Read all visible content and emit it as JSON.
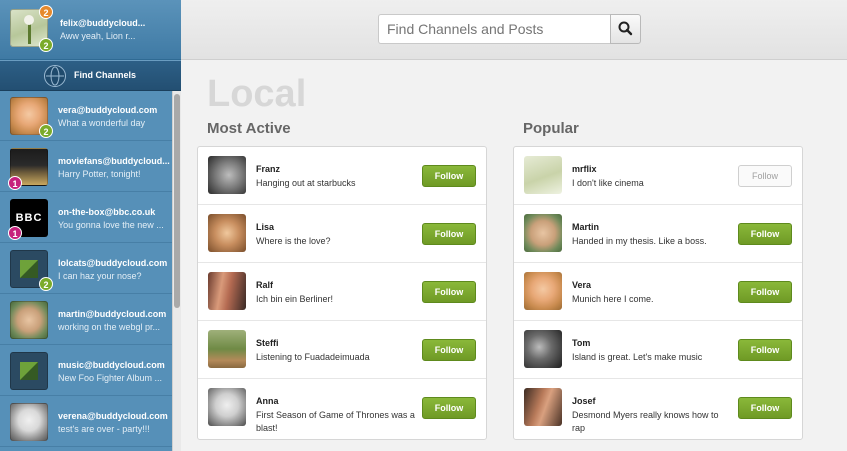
{
  "me": {
    "name": "felix@buddycloud...",
    "status": "Aww yeah, Lion r...",
    "badge_top": "2",
    "badge_bottom": "2"
  },
  "find_channels_label": "Find Channels",
  "channels": [
    {
      "name": "vera@buddycloud.com",
      "status": "What a wonderful day",
      "badge": "2",
      "badge_color": "#7bab2a"
    },
    {
      "name": "moviefans@buddycloud...",
      "status": "Harry Potter, tonight!",
      "badge": "1",
      "badge_color": "#c6207c"
    },
    {
      "name": "on-the-box@bbc.co.uk",
      "status": "You gonna love the new ...",
      "badge": "1",
      "badge_color": "#c6207c",
      "logo": "BBC"
    },
    {
      "name": "lolcats@buddycloud.com",
      "status": "I can haz your nose?",
      "badge": "2",
      "badge_color": "#7bab2a"
    },
    {
      "name": "martin@buddycloud.com",
      "status": "working on the webgl pr...",
      "badge": "",
      "badge_color": ""
    },
    {
      "name": "music@buddycloud.com",
      "status": "New Foo Fighter Album ...",
      "badge": "",
      "badge_color": ""
    },
    {
      "name": "verena@buddycloud.com",
      "status": "test's are over - party!!!",
      "badge": "",
      "badge_color": ""
    }
  ],
  "search": {
    "placeholder": "Find Channels and Posts"
  },
  "local_title": "Local",
  "most_active": {
    "title": "Most Active",
    "users": [
      {
        "name": "Franz",
        "status": "Hanging out at starbucks",
        "action": "Follow"
      },
      {
        "name": "Lisa",
        "status": "Where is the love?",
        "action": "Follow"
      },
      {
        "name": "Ralf",
        "status": "Ich bin ein Berliner!",
        "action": "Follow"
      },
      {
        "name": "Steffi",
        "status": "Listening to Fuadadeimuada",
        "action": "Follow"
      },
      {
        "name": "Anna",
        "status": "First Season of Game of Thrones was a blast!",
        "action": "Follow"
      }
    ]
  },
  "popular": {
    "title": "Popular",
    "users": [
      {
        "name": "mrflix",
        "status": "I don't like cinema",
        "action": "Follow",
        "disabled": true
      },
      {
        "name": "Martin",
        "status": "Handed in my thesis. Like a boss.",
        "action": "Follow"
      },
      {
        "name": "Vera",
        "status": "Munich here I come.",
        "action": "Follow"
      },
      {
        "name": "Tom",
        "status": "Island is great. Let's make music",
        "action": "Follow"
      },
      {
        "name": "Josef",
        "status": "Desmond Myers really knows how to rap",
        "action": "Follow"
      }
    ]
  },
  "colors": {
    "accent_green": "#7bab2a",
    "sidebar_blue": "#4f8bb3",
    "badge_pink": "#c6207c",
    "badge_orange": "#e6892c"
  }
}
